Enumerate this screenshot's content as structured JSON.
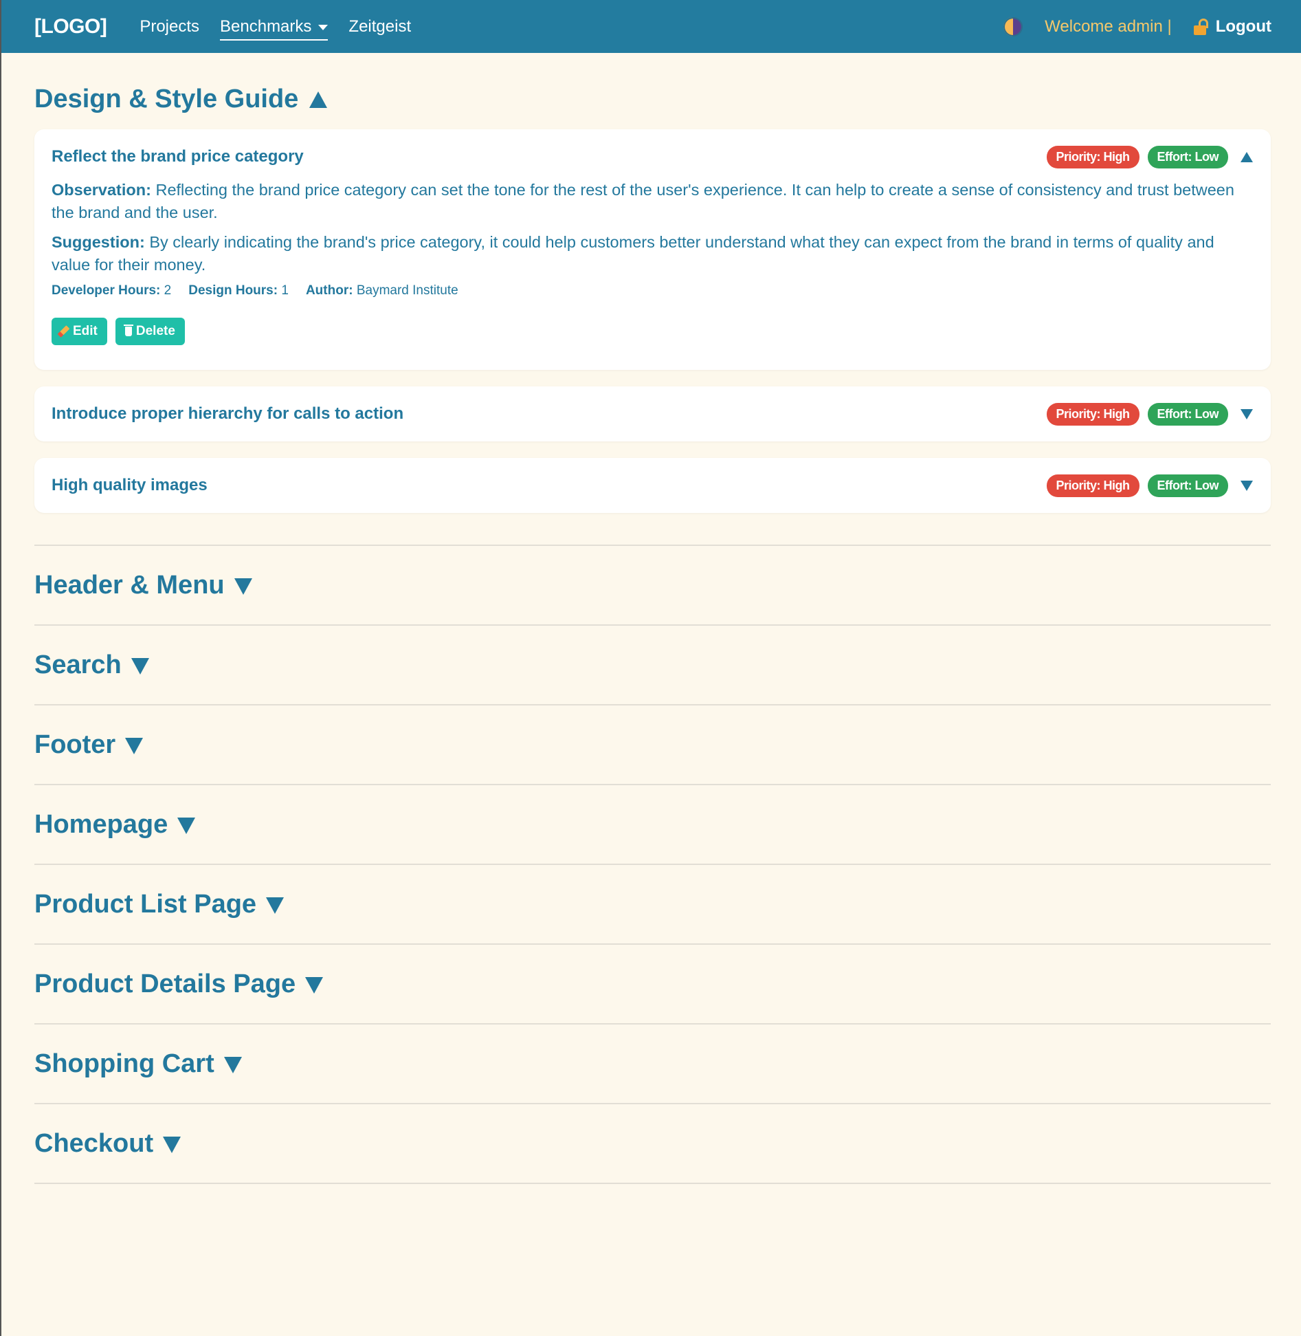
{
  "navbar": {
    "logo": "[LOGO]",
    "links": [
      {
        "label": "Projects"
      },
      {
        "label": "Benchmarks"
      },
      {
        "label": "Zeitgeist"
      }
    ],
    "welcome": "Welcome admin |",
    "logout_label": "Logout"
  },
  "sections": [
    {
      "title": "Design & Style Guide",
      "expanded": true,
      "items": [
        {
          "title": "Reflect the brand price category",
          "priority": "Priority: High",
          "effort": "Effort: Low",
          "expanded": true,
          "observation_label": "Observation:",
          "observation": "Reflecting the brand price category can set the tone for the rest of the user's experience. It can help to create a sense of consistency and trust between the brand and the user.",
          "suggestion_label": "Suggestion:",
          "suggestion": "By clearly indicating the brand's price category, it could help customers better understand what they can expect from the brand in terms of quality and value for their money.",
          "developer_hours_label": "Developer Hours:",
          "developer_hours": "2",
          "design_hours_label": "Design Hours:",
          "design_hours": "1",
          "author_label": "Author:",
          "author": "Baymard Institute",
          "edit_label": "Edit",
          "delete_label": "Delete"
        },
        {
          "title": "Introduce proper hierarchy for calls to action",
          "priority": "Priority: High",
          "effort": "Effort: Low",
          "expanded": false
        },
        {
          "title": "High quality images",
          "priority": "Priority: High",
          "effort": "Effort: Low",
          "expanded": false
        }
      ]
    },
    {
      "title": "Header & Menu",
      "expanded": false
    },
    {
      "title": "Search",
      "expanded": false
    },
    {
      "title": "Footer",
      "expanded": false
    },
    {
      "title": "Homepage",
      "expanded": false
    },
    {
      "title": "Product List Page",
      "expanded": false
    },
    {
      "title": "Product Details Page",
      "expanded": false
    },
    {
      "title": "Shopping Cart",
      "expanded": false
    },
    {
      "title": "Checkout",
      "expanded": false
    }
  ],
  "colors": {
    "navbar_bg": "#237c9f",
    "page_bg": "#fdf8ec",
    "accent_text": "#23789d",
    "priority_badge": "#e2493c",
    "effort_badge": "#2fa459",
    "button": "#1fbfa8",
    "welcome_text": "#f5c86b"
  }
}
